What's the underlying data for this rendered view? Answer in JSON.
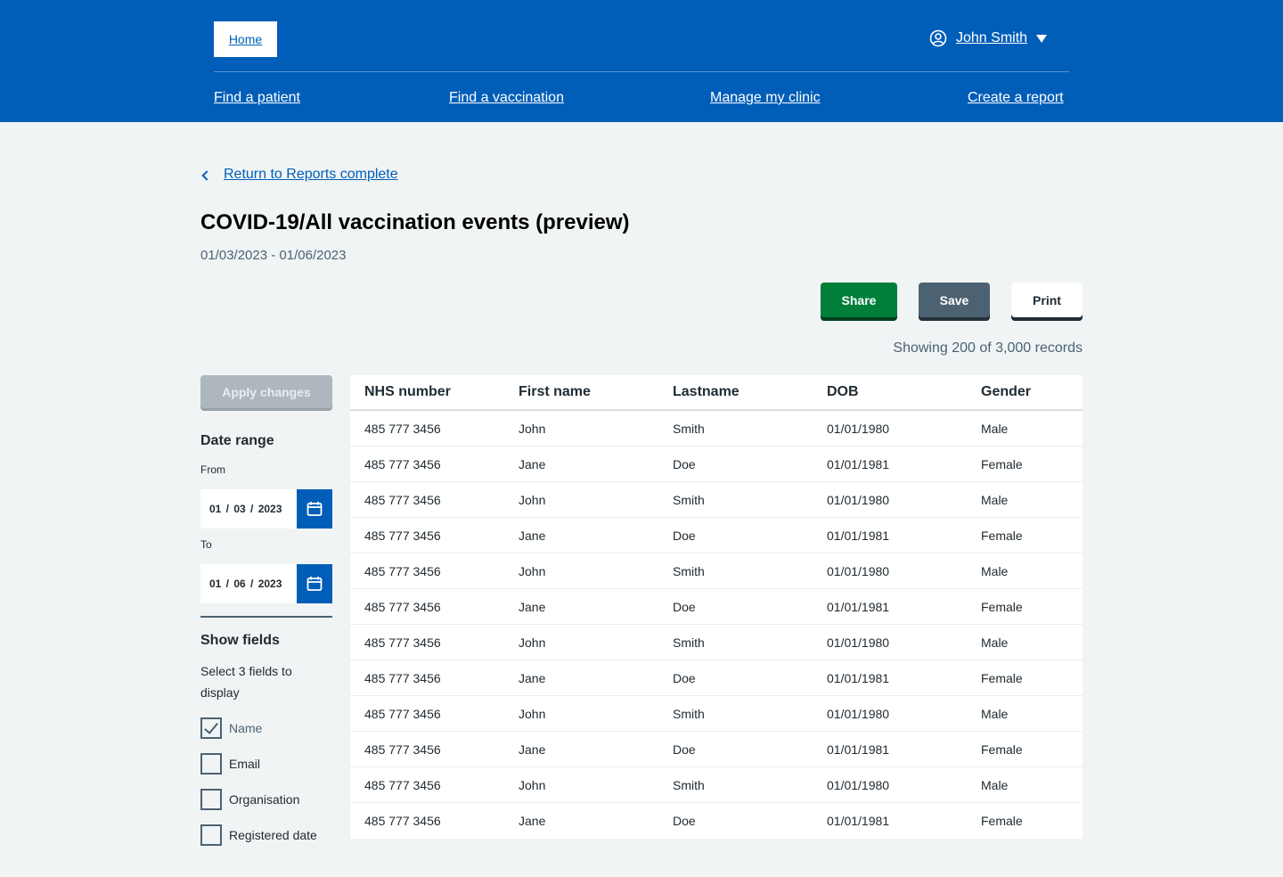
{
  "header": {
    "home_label": "Home",
    "user_name": "John Smith",
    "nav": [
      {
        "label": "Find a patient"
      },
      {
        "label": "Find a vaccination"
      },
      {
        "label": "Manage my clinic"
      },
      {
        "label": "Create a report"
      }
    ]
  },
  "back_link": "Return to Reports complete",
  "page_title": "COVID-19/All vaccination events (preview)",
  "date_range": "01/03/2023 - 01/06/2023",
  "actions": {
    "share": "Share",
    "save": "Save",
    "print": "Print"
  },
  "showing": "Showing 200 of 3,000 records",
  "sidebar": {
    "apply": "Apply changes",
    "date_range_heading": "Date range",
    "from_label": "From",
    "from_value": "01  /  03  /  2023",
    "to_label": "To",
    "to_value": "01  /  06  /  2023",
    "show_fields_heading": "Show fields",
    "show_fields_hint": "Select 3 fields to display",
    "fields": [
      {
        "label": "Name",
        "checked": true
      },
      {
        "label": "Email",
        "checked": false
      },
      {
        "label": "Organisation",
        "checked": false
      },
      {
        "label": "Registered date",
        "checked": false
      }
    ]
  },
  "table": {
    "headers": [
      "NHS number",
      "First name",
      "Lastname",
      "DOB",
      "Gender"
    ],
    "rows": [
      [
        "485 777 3456",
        "John",
        "Smith",
        "01/01/1980",
        "Male"
      ],
      [
        "485 777 3456",
        "Jane",
        "Doe",
        "01/01/1981",
        "Female"
      ],
      [
        "485 777 3456",
        "John",
        "Smith",
        "01/01/1980",
        "Male"
      ],
      [
        "485 777 3456",
        "Jane",
        "Doe",
        "01/01/1981",
        "Female"
      ],
      [
        "485 777 3456",
        "John",
        "Smith",
        "01/01/1980",
        "Male"
      ],
      [
        "485 777 3456",
        "Jane",
        "Doe",
        "01/01/1981",
        "Female"
      ],
      [
        "485 777 3456",
        "John",
        "Smith",
        "01/01/1980",
        "Male"
      ],
      [
        "485 777 3456",
        "Jane",
        "Doe",
        "01/01/1981",
        "Female"
      ],
      [
        "485 777 3456",
        "John",
        "Smith",
        "01/01/1980",
        "Male"
      ],
      [
        "485 777 3456",
        "Jane",
        "Doe",
        "01/01/1981",
        "Female"
      ],
      [
        "485 777 3456",
        "John",
        "Smith",
        "01/01/1980",
        "Male"
      ],
      [
        "485 777 3456",
        "Jane",
        "Doe",
        "01/01/1981",
        "Female"
      ]
    ]
  },
  "colors": {
    "header_blue": "#005eb8",
    "share_green": "#007f3b",
    "save_grey": "#4c6272",
    "background": "#f0f4f5"
  }
}
